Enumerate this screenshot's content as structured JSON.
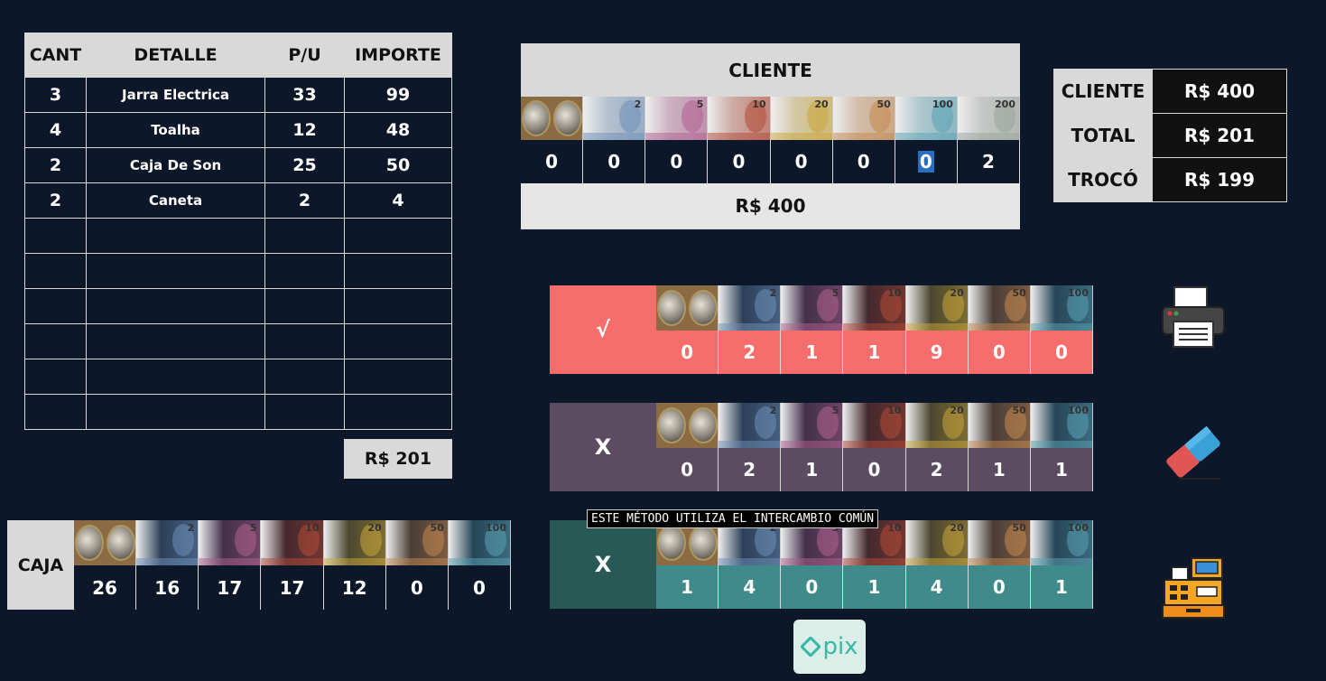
{
  "items": {
    "headers": [
      "CANT",
      "DETALLE",
      "P/U",
      "IMPORTE"
    ],
    "rows": [
      [
        "3",
        "Jarra Electrica",
        "33",
        "99"
      ],
      [
        "4",
        "Toalha",
        "12",
        "48"
      ],
      [
        "2",
        "Caja De Son",
        "25",
        "50"
      ],
      [
        "2",
        "Caneta",
        "2",
        "4"
      ],
      [
        "",
        "",
        "",
        ""
      ],
      [
        "",
        "",
        "",
        ""
      ],
      [
        "",
        "",
        "",
        ""
      ],
      [
        "",
        "",
        "",
        ""
      ],
      [
        "",
        "",
        "",
        ""
      ],
      [
        "",
        "",
        "",
        ""
      ]
    ],
    "total": "R$ 201"
  },
  "cliente": {
    "title": "CLIENTE",
    "denominations": [
      "coins",
      "2",
      "5",
      "10",
      "20",
      "50",
      "100",
      "200"
    ],
    "values": [
      "0",
      "0",
      "0",
      "0",
      "0",
      "0",
      "0",
      "2"
    ],
    "total": "R$ 400"
  },
  "summary": [
    {
      "label": "CLIENTE",
      "value": "R$ 400"
    },
    {
      "label": "TOTAL",
      "value": "R$ 201"
    },
    {
      "label": "TROCÓ",
      "value": "R$ 199"
    }
  ],
  "panels": [
    {
      "label": "√",
      "values": [
        "0",
        "2",
        "1",
        "1",
        "9",
        "0",
        "0"
      ]
    },
    {
      "label": "X",
      "values": [
        "0",
        "2",
        "1",
        "0",
        "2",
        "1",
        "1"
      ]
    },
    {
      "label": "X",
      "values": [
        "1",
        "4",
        "0",
        "1",
        "4",
        "0",
        "1"
      ]
    }
  ],
  "tooltip": "ESTE MÉTODO UTILIZA EL INTERCAMBIO COMÚN",
  "caja": {
    "label": "CAJA",
    "values": [
      "26",
      "16",
      "17",
      "17",
      "12",
      "0",
      "0"
    ]
  },
  "note_colors": {
    "2": "#6d8fb8",
    "5": "#b0608e",
    "10": "#b24a37",
    "20": "#c9a53b",
    "50": "#c48850",
    "100": "#5aa2b4",
    "200": "#9aa39b"
  },
  "icons": [
    "printer-icon",
    "eraser-icon",
    "cash-register-icon",
    "pix-logo"
  ],
  "pix_text": "pix"
}
